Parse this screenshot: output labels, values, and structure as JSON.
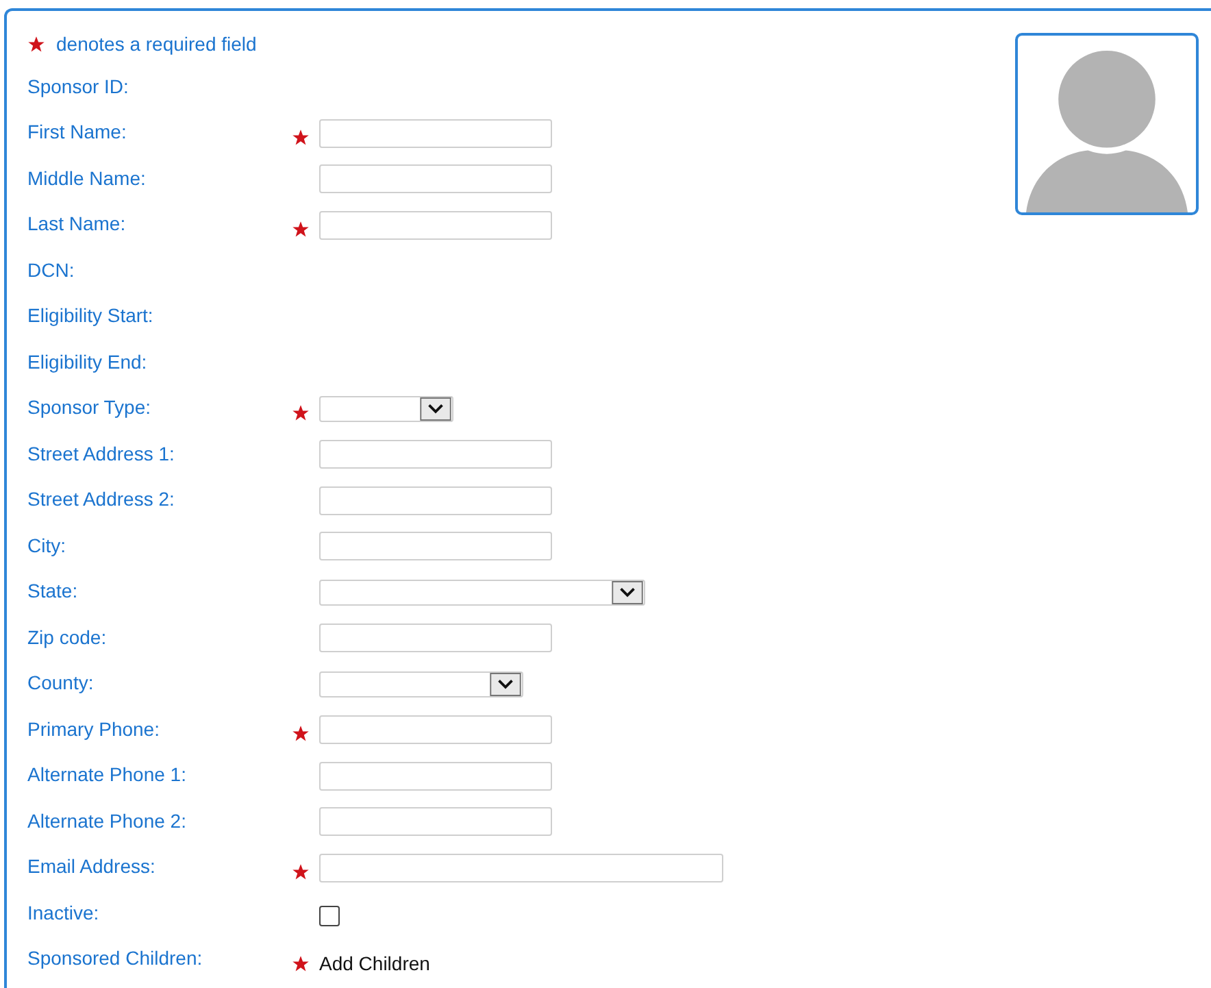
{
  "required_note": "denotes a required field",
  "fields": [
    {
      "label": "Sponsor ID:",
      "required": false,
      "kind": "none"
    },
    {
      "label": "First Name:",
      "required": true,
      "kind": "text"
    },
    {
      "label": "Middle Name:",
      "required": false,
      "kind": "text"
    },
    {
      "label": "Last Name:",
      "required": true,
      "kind": "text"
    },
    {
      "label": "DCN:",
      "required": false,
      "kind": "none"
    },
    {
      "label": "Eligibility Start:",
      "required": false,
      "kind": "none"
    },
    {
      "label": "Eligibility End:",
      "required": false,
      "kind": "none"
    },
    {
      "label": "Sponsor Type:",
      "required": true,
      "kind": "select"
    },
    {
      "label": "Street Address 1:",
      "required": false,
      "kind": "text"
    },
    {
      "label": "Street Address 2:",
      "required": false,
      "kind": "text"
    },
    {
      "label": "City:",
      "required": false,
      "kind": "text"
    },
    {
      "label": "State:",
      "required": false,
      "kind": "select"
    },
    {
      "label": "Zip code:",
      "required": false,
      "kind": "text"
    },
    {
      "label": "County:",
      "required": false,
      "kind": "select"
    },
    {
      "label": "Primary Phone:",
      "required": true,
      "kind": "text"
    },
    {
      "label": "Alternate Phone 1:",
      "required": false,
      "kind": "text"
    },
    {
      "label": "Alternate Phone 2:",
      "required": false,
      "kind": "text"
    },
    {
      "label": "Email Address:",
      "required": true,
      "kind": "text"
    },
    {
      "label": "Inactive:",
      "required": false,
      "kind": "checkbox",
      "checked": false
    },
    {
      "label": "Sponsored Children:",
      "required": true,
      "kind": "action",
      "text": "Add Children"
    }
  ]
}
